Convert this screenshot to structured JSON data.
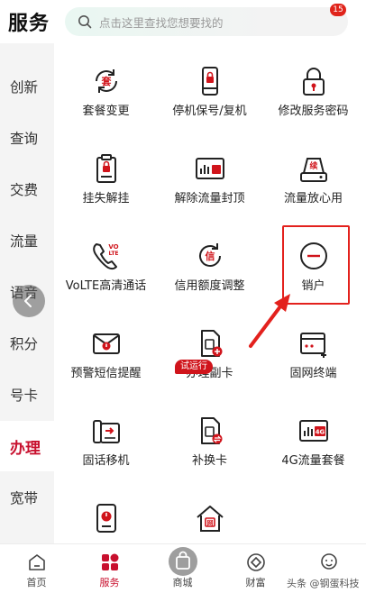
{
  "header": {
    "title": "服务",
    "search_placeholder": "点击这里查找您想要找的",
    "search_icon": "search-icon"
  },
  "sidebar": {
    "items": [
      {
        "label": "创新"
      },
      {
        "label": "查询"
      },
      {
        "label": "交费"
      },
      {
        "label": "流量"
      },
      {
        "label": "语音"
      },
      {
        "label": "积分"
      },
      {
        "label": "号卡"
      },
      {
        "label": "办理",
        "active": true
      },
      {
        "label": "宽带"
      }
    ],
    "back_icon": "chevron-left-icon"
  },
  "grid": {
    "items": [
      {
        "label": "套餐变更",
        "icon": "package-change-icon"
      },
      {
        "label": "停机保号/复机",
        "icon": "phone-lock-icon"
      },
      {
        "label": "修改服务密码",
        "icon": "padlock-icon"
      },
      {
        "label": "挂失解挂",
        "icon": "report-loss-icon"
      },
      {
        "label": "解除流量封顶",
        "icon": "traffic-cap-icon"
      },
      {
        "label": "流量放心用",
        "icon": "data-router-icon"
      },
      {
        "label": "VoLTE高清通话",
        "icon": "volte-icon"
      },
      {
        "label": "信用额度调整",
        "icon": "credit-adjust-icon"
      },
      {
        "label": "销户",
        "icon": "minus-circle-icon"
      },
      {
        "label": "预警短信提醒",
        "icon": "sms-alert-icon"
      },
      {
        "label": "办理副卡",
        "icon": "sim-card-add-icon"
      },
      {
        "label": "固网终端",
        "icon": "fixed-terminal-icon"
      },
      {
        "label": "固话移机",
        "icon": "landline-move-icon"
      },
      {
        "label": "补换卡",
        "icon": "sim-replace-icon"
      },
      {
        "label": "4G流量套餐",
        "icon": "4g-package-icon"
      },
      {
        "label": "",
        "icon": "power-device-icon"
      },
      {
        "label": "",
        "icon": "broadband-house-icon"
      }
    ],
    "trial_badge": "试运行",
    "icon_glyphs": {
      "package": "套",
      "credit": "信",
      "renew": "续",
      "house": "网",
      "fourg": "4G",
      "volte_top": "VO",
      "volte_bottom": "LTE"
    }
  },
  "tabbar": {
    "items": [
      {
        "label": "首页",
        "icon": "home-icon"
      },
      {
        "label": "服务",
        "icon": "service-icon",
        "active": true
      },
      {
        "label": "商城",
        "icon": "shopping-bag-icon"
      },
      {
        "label": "财富",
        "icon": "wealth-icon"
      },
      {
        "label": "",
        "icon": "profile-icon"
      }
    ],
    "badge": "15"
  },
  "watermark": "头条 @钢蛋科技",
  "colors": {
    "accent": "#c8102e",
    "highlight": "#e3211d",
    "sidebar_bg": "#f4f4f4"
  }
}
